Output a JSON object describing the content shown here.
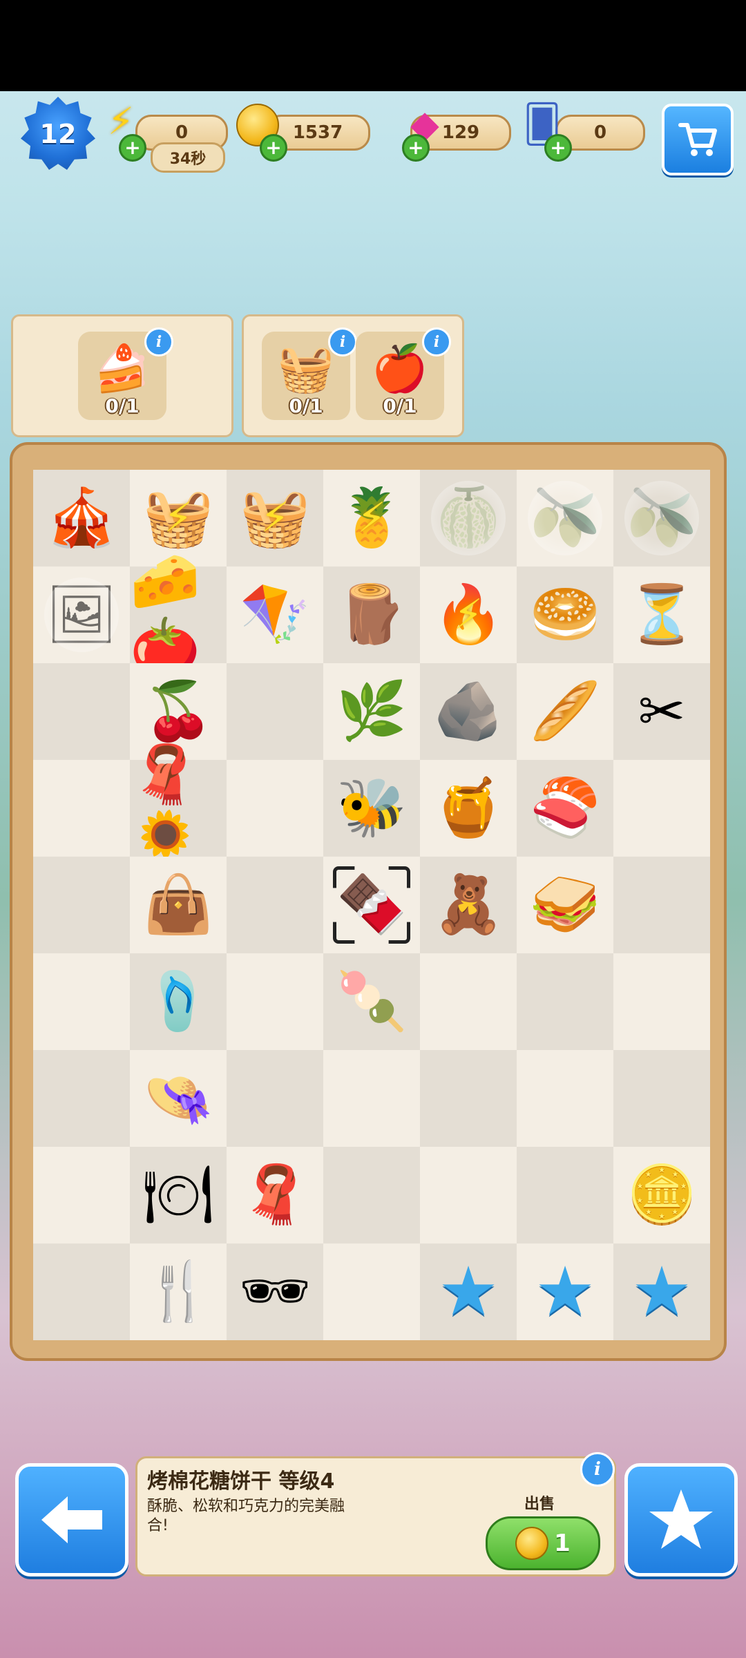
{
  "hud": {
    "level": "12",
    "energy": "0",
    "energy_timer": "34秒",
    "coins": "1537",
    "gems": "129",
    "cards": "0"
  },
  "orders": [
    {
      "items": [
        {
          "icon": "🍰",
          "name": "cake-slice",
          "count": "0/1"
        }
      ]
    },
    {
      "items": [
        {
          "icon": "🧺",
          "name": "picnic-set",
          "count": "0/1"
        },
        {
          "icon": "🍎",
          "name": "apple",
          "count": "0/1"
        }
      ]
    }
  ],
  "board": [
    [
      "🎪",
      "🧺⚡",
      "🧺⚡",
      "🍍⚡",
      "🍈w",
      "🫒w",
      "🫒w"
    ],
    [
      "🖼w",
      "🧀🍅",
      "🪁",
      "🪵",
      "🔥⚡",
      "🥯",
      "⏳"
    ],
    [
      "",
      "🍒",
      "",
      "🌿",
      "🪨",
      "🥖",
      "✂"
    ],
    [
      "",
      "🧣🌻",
      "",
      "🐝",
      "🍯",
      "🍣",
      ""
    ],
    [
      "",
      "👜",
      "",
      "🍫s",
      "🧸",
      "🥪",
      ""
    ],
    [
      "",
      "🩴",
      "",
      "🍡",
      "",
      "",
      ""
    ],
    [
      "",
      "👒",
      "",
      "",
      "",
      "",
      ""
    ],
    [
      "",
      "🍽",
      "🧣",
      "",
      "",
      "",
      "🪙"
    ],
    [
      "",
      "🍴",
      "🕶",
      "",
      "★",
      "✶",
      "✷"
    ]
  ],
  "selected_item": {
    "title": "烤棉花糖饼干 等级4",
    "description": "酥脆、松软和巧克力的完美融合!",
    "sell_label": "出售",
    "sell_price": "1"
  },
  "colors": {
    "accent": "#1f7ee0",
    "board_light": "#f4eee4",
    "board_dark": "#e4ded4",
    "frame": "#d9b079"
  }
}
